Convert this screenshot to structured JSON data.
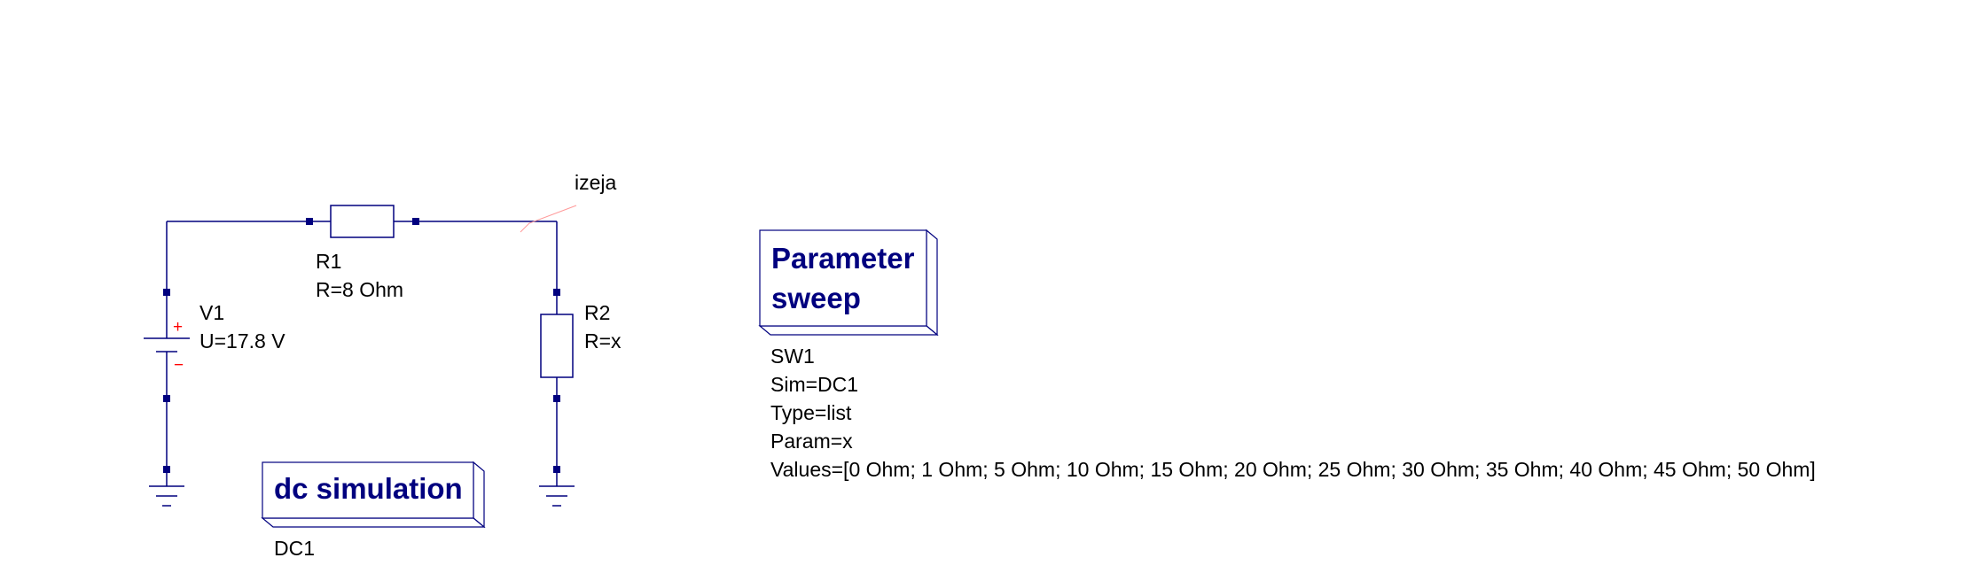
{
  "colors": {
    "wire": "#00007f",
    "port": "#00007f",
    "text": "#000000",
    "block_title": "#00007f",
    "polarity": "#ff0000",
    "node_label_line": "#ff9999"
  },
  "components": {
    "R1": {
      "name": "R1",
      "param": "R=8 Ohm"
    },
    "R2": {
      "name": "R2",
      "param": "R=x"
    },
    "V1": {
      "name": "V1",
      "param": "U=17.8 V",
      "plus_sign": "+",
      "minus_sign": "−"
    }
  },
  "node_label": "izeja",
  "dc_simulation": {
    "title": "dc simulation",
    "name": "DC1"
  },
  "parameter_sweep": {
    "title_line1": "Parameter",
    "title_line2": "sweep",
    "name": "SW1",
    "sim": "Sim=DC1",
    "type": "Type=list",
    "param": "Param=x",
    "values": "Values=[0 Ohm; 1 Ohm; 5 Ohm; 10 Ohm; 15 Ohm; 20 Ohm; 25 Ohm; 30 Ohm; 35 Ohm; 40 Ohm; 45 Ohm; 50 Ohm]"
  }
}
